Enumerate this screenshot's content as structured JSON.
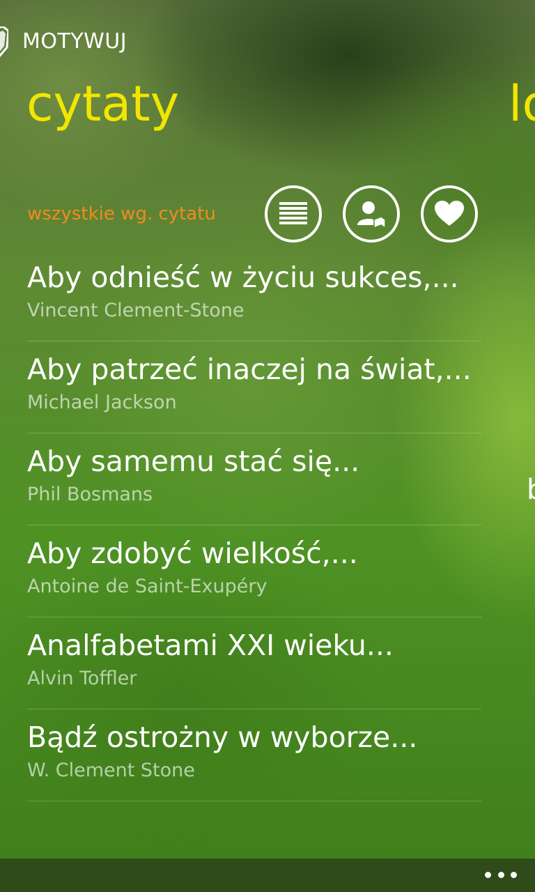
{
  "app": {
    "title": "MOTYWUJ",
    "logo_icon": "shield-icon"
  },
  "pivot": {
    "current_title": "cytaty",
    "next_title_peek": "lo"
  },
  "filter": {
    "label": "wszystkie wg. cytatu"
  },
  "toolbar": {
    "buttons": [
      {
        "icon": "list-icon"
      },
      {
        "icon": "authors-icon"
      },
      {
        "icon": "heart-icon"
      }
    ]
  },
  "quotes": [
    {
      "text": "Aby odnieść w życiu sukces,...",
      "author": "Vincent Clement-Stone"
    },
    {
      "text": "Aby patrzeć inaczej na świat,...",
      "author": "Michael Jackson"
    },
    {
      "text": "Aby samemu stać się...",
      "author": "Phil Bosmans"
    },
    {
      "text": "Aby zdobyć wielkość,...",
      "author": "Antoine de Saint-Exupéry"
    },
    {
      "text": "Analfabetami XXI wieku...",
      "author": "Alvin Toffler"
    },
    {
      "text": "Bądź ostrożny w wyborze...",
      "author": "W. Clement Stone"
    }
  ],
  "next_page_peek": {
    "char1": "",
    "char2": "b"
  },
  "app_bar": {
    "more_icon": "ellipsis-icon"
  },
  "colors": {
    "accent_title": "#f2e600",
    "accent_filter": "#f28c1b"
  }
}
